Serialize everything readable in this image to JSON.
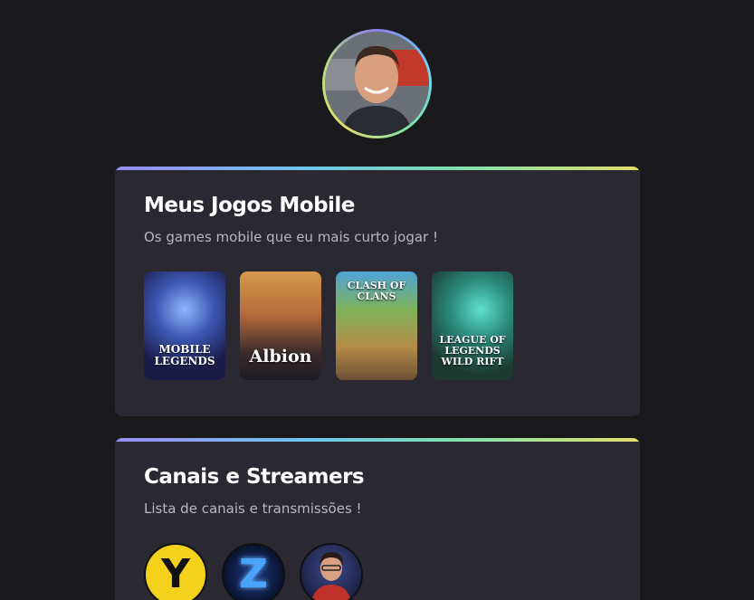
{
  "profile": {
    "avatar_icon": "profile-photo"
  },
  "games_section": {
    "title": "Meus Jogos Mobile",
    "subtitle": "Os games mobile que eu mais curto jogar !",
    "games": [
      {
        "label": "MOBILE LEGENDS",
        "icon": "mobile-legends-cover"
      },
      {
        "label": "Albion",
        "icon": "albion-online-cover"
      },
      {
        "label": "CLASH OF CLANS",
        "icon": "clash-of-clans-cover"
      },
      {
        "label": "LEAGUE OF LEGENDS WILD RIFT",
        "icon": "wild-rift-cover"
      }
    ]
  },
  "channels_section": {
    "title": "Canais e Streamers",
    "subtitle": "Lista de canais e transmissões !",
    "channels": [
      {
        "letter": "Y",
        "icon": "channel-logo-y"
      },
      {
        "letter": "Z",
        "icon": "channel-logo-z"
      },
      {
        "letter": "",
        "icon": "streamer-avatar"
      }
    ]
  }
}
